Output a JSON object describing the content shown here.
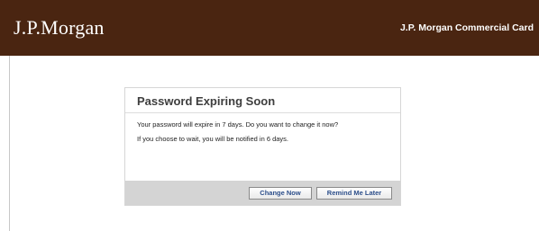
{
  "header": {
    "logo_text": "J.P.Morgan",
    "title": "J.P. Morgan Commercial Card",
    "background_color": "#4a2511"
  },
  "dialog": {
    "title": "Password Expiring Soon",
    "message_line1": "Your password will expire in 7 days. Do you want to change it now?",
    "message_line2": "If you choose to wait, you will be notified in 6 days.",
    "buttons": {
      "change_now": "Change Now",
      "remind_later": "Remind Me Later"
    }
  }
}
